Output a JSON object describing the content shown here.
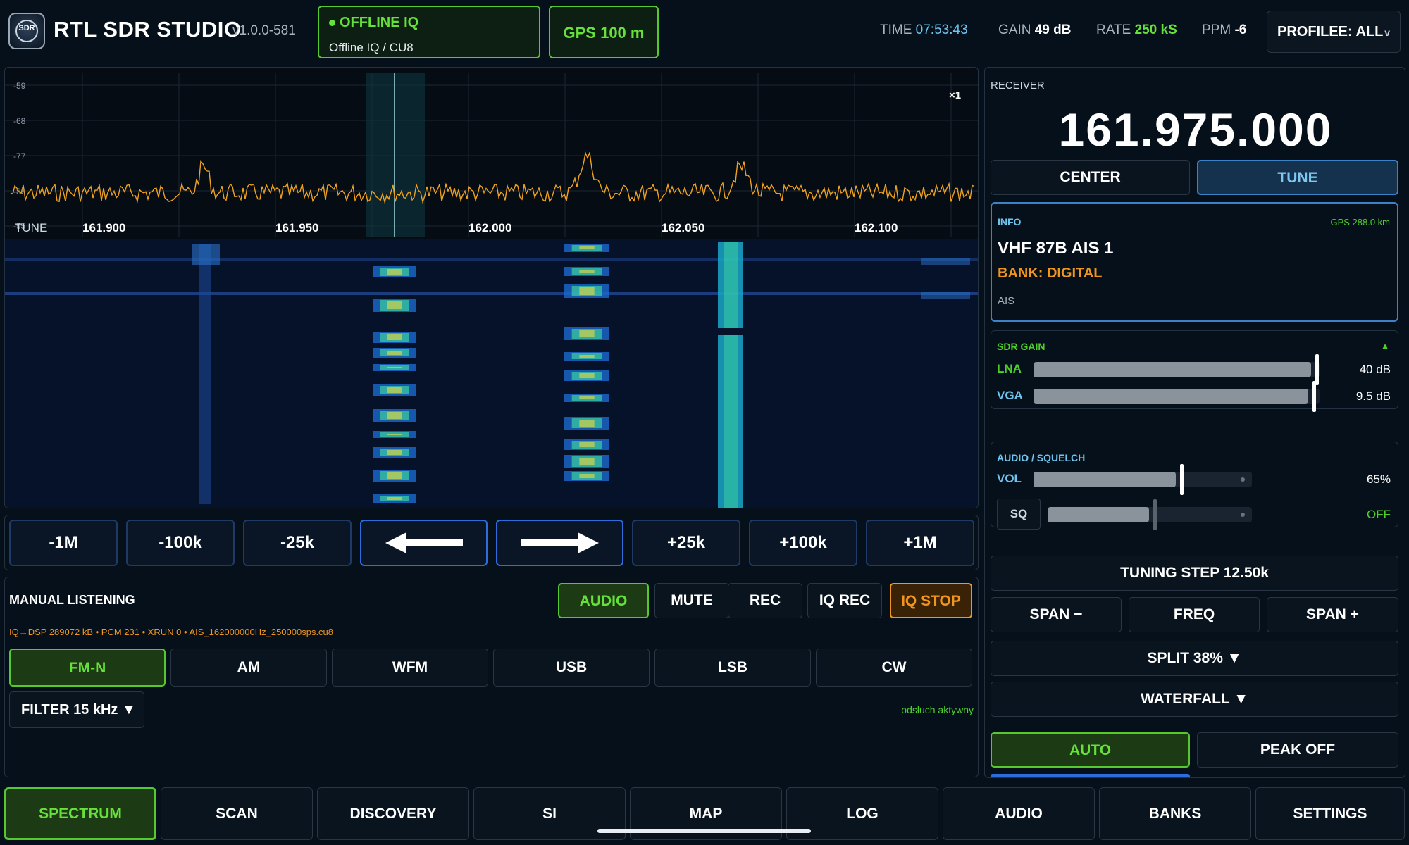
{
  "header": {
    "logo_text": "SDR",
    "app_title": "RTL SDR STUDIO",
    "version": "v1.0.0-581",
    "source_status": "OFFLINE IQ",
    "source_detail": "Offline IQ / CU8",
    "gps": "GPS 100 m",
    "time_label": "TIME",
    "time_value": "07:53:43",
    "gain_label": "GAIN",
    "gain_value": "49 dB",
    "rate_label": "RATE",
    "rate_value": "250 kS",
    "ppm_label": "PPM",
    "ppm_value": "-6",
    "profile": "PROFILEE: ALL"
  },
  "spectrum": {
    "db_ticks": [
      "-59",
      "-68",
      "-77",
      "-86",
      "-95"
    ],
    "freq_ticks": [
      "161.900",
      "161.950",
      "162.000",
      "162.050",
      "162.100"
    ],
    "tune_label": "TUNE",
    "zoom": "×1"
  },
  "steps": [
    "-1M",
    "-100k",
    "-25k",
    "←",
    "→",
    "+25k",
    "+100k",
    "+1M"
  ],
  "manual": {
    "title": "MANUAL LISTENING",
    "buttons": [
      "AUDIO",
      "MUTE",
      "REC",
      "IQ REC",
      "IQ STOP"
    ],
    "status_line": "IQ→DSP 289072 kB • PCM 231 • XRUN 0 • AIS_162000000Hz_250000sps.cu8",
    "modes": [
      "FM-N",
      "AM",
      "WFM",
      "USB",
      "LSB",
      "CW"
    ],
    "active_mode": "FM-N",
    "filter": "FILTER 15 kHz ▼",
    "listening_status": "odsłuch aktywny"
  },
  "receiver": {
    "label": "RECEIVER",
    "frequency": "161.975.000",
    "center": "CENTER",
    "tune": "TUNE"
  },
  "info": {
    "label": "INFO",
    "gps_distance": "GPS 288.0 km",
    "name": "VHF 87B AIS 1",
    "bank": "BANK: DIGITAL",
    "type": "AIS"
  },
  "sdr_gain": {
    "title": "SDR GAIN",
    "collapse_icon": "▲",
    "lna_label": "LNA",
    "lna_value": "40 dB",
    "lna_level": 0.97,
    "vga_label": "VGA",
    "vga_value": "9.5 dB",
    "vga_level": 0.96
  },
  "audio_squelch": {
    "title": "AUDIO / SQUELCH",
    "vol_label": "VOL",
    "vol_value": "65%",
    "vol_level": 0.65,
    "sq_label": "SQ",
    "sq_value": "OFF"
  },
  "controls": {
    "tuning_step": "TUNING STEP  12.50k",
    "span_minus": "SPAN −",
    "freq": "FREQ",
    "span_plus": "SPAN +",
    "split": "SPLIT  38%  ▼",
    "waterfall": "WATERFALL  ▼",
    "auto": "AUTO",
    "peak": "PEAK OFF"
  },
  "nav": [
    "SPECTRUM",
    "SCAN",
    "DISCOVERY",
    "SI",
    "MAP",
    "LOG",
    "AUDIO",
    "BANKS",
    "SETTINGS"
  ],
  "active_nav": "SPECTRUM",
  "colors": {
    "accent_green": "#66e03a",
    "accent_orange": "#f0961e",
    "accent_blue": "#6ec6f0",
    "trace": "#f0a21e"
  }
}
